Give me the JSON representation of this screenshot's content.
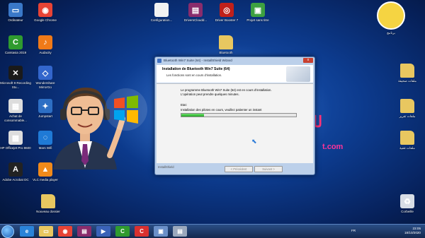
{
  "desktop": {
    "icons": [
      {
        "label": "Ordinateur",
        "icon": "computer-icon",
        "color": "#3a78c8",
        "glyph": "▭"
      },
      {
        "label": "Google Chrome",
        "icon": "chrome-icon",
        "color": "#e84335",
        "glyph": "◉"
      },
      {
        "label": "Configuration...",
        "icon": "file-icon",
        "color": "#f2f2f2",
        "glyph": ""
      },
      {
        "label": "DriversCloudd...",
        "icon": "winrar-icon",
        "color": "#8a2c6c",
        "glyph": "▤"
      },
      {
        "label": "Driver Booster 7",
        "icon": "driver-booster-icon",
        "color": "#c0201a",
        "glyph": "◎"
      },
      {
        "label": "Projet sans titre",
        "icon": "project-icon",
        "color": "#3da040",
        "glyph": "▣"
      },
      {
        "label": "Camtasia 2019",
        "icon": "camtasia-icon",
        "color": "#2f9b2f",
        "glyph": "C"
      },
      {
        "label": "Audacity",
        "icon": "audacity-icon",
        "color": "#f07a18",
        "glyph": "♪"
      },
      {
        "label": "Bluetooth",
        "icon": "folder-icon",
        "color": "#e8c760",
        "glyph": ""
      },
      {
        "label": "Microsoft 9 Recording Stu...",
        "icon": "recording-icon",
        "color": "#1a1a1a",
        "glyph": "✕"
      },
      {
        "label": "Wondershare MirrorGo",
        "icon": "mirrorgo-icon",
        "color": "#3366cc",
        "glyph": "◇"
      },
      {
        "label": "Achat de consommable...",
        "icon": "printer-icon",
        "color": "#dddddd",
        "glyph": "▦"
      },
      {
        "label": "Jumpstart",
        "icon": "jumpstart-icon",
        "color": "#2d6fc4",
        "glyph": "✦"
      },
      {
        "label": "HP Officejet Pro 8600",
        "icon": "hp-printer-icon",
        "color": "#dddddd",
        "glyph": "▦"
      },
      {
        "label": "Mars Wifi",
        "icon": "wifi-icon",
        "color": "#1f7ad6",
        "glyph": "◌"
      },
      {
        "label": "Adobe Acrobat DC",
        "icon": "acrobat-icon",
        "color": "#222222",
        "glyph": "A"
      },
      {
        "label": "VLC media player",
        "icon": "vlc-icon",
        "color": "#f08a1a",
        "glyph": "▲"
      },
      {
        "label": "Nouveau dossier",
        "icon": "folder-icon",
        "color": "#e8c760",
        "glyph": ""
      },
      {
        "label": "برنامج",
        "icon": "mascot-avatar-icon",
        "color": "#f5d442",
        "glyph": ""
      },
      {
        "label": "ملفات صحيفة",
        "icon": "folder-icon",
        "color": "#e8c760",
        "glyph": ""
      },
      {
        "label": "ملفات تقرير",
        "icon": "folder-icon",
        "color": "#e8c760",
        "glyph": ""
      },
      {
        "label": "ملفات تقنية",
        "icon": "folder-icon",
        "color": "#e8c760",
        "glyph": ""
      },
      {
        "label": "Corbeille",
        "icon": "recycle-bin-icon",
        "color": "#d8dde6",
        "glyph": "♻"
      }
    ],
    "pink_text": "لك",
    "site_text": "t.com"
  },
  "installer": {
    "title": "Bluetooth Win7 Suite (64) - InstallShield Wizard",
    "header_title": "Installation de Bluetooth Win7 Suite (64)",
    "header_subtitle": "Les fonctions sont en cours d'installation.",
    "description": "Le programme Bluetooth Win7 Suite (64) est en cours d'installation. L'opération peut prendre quelques minutes.",
    "status_label": "Etat:",
    "status_text": "Installation des pilotes en cours, veuillez patienter un instant",
    "progress": 0.2,
    "brand": "InstallShield",
    "prev_label": "< Précédent",
    "next_label": "Suivant >",
    "close_label": "x"
  },
  "taskbar": {
    "items": [
      {
        "icon": "ie-icon",
        "color": "#2a83d8",
        "glyph": "e"
      },
      {
        "icon": "explorer-folder-icon",
        "color": "#e8c760",
        "glyph": "▭"
      },
      {
        "icon": "chrome-icon",
        "color": "#e84335",
        "glyph": "◉"
      },
      {
        "icon": "winrar-icon",
        "color": "#8a2c6c",
        "glyph": "▤"
      },
      {
        "icon": "mediaplayer-icon",
        "color": "#3a62b8",
        "glyph": "▶"
      },
      {
        "icon": "camtasia-icon",
        "color": "#2f9b2f",
        "glyph": "C"
      },
      {
        "icon": "camtasia-recorder-icon",
        "color": "#d83030",
        "glyph": "C"
      },
      {
        "icon": "installer-icon",
        "color": "#6a8fc8",
        "glyph": "▣"
      },
      {
        "icon": "setup-icon",
        "color": "#9aa8bd",
        "glyph": "▤"
      }
    ],
    "lang": "FR",
    "time": "23:05",
    "date": "18/10/2020"
  }
}
